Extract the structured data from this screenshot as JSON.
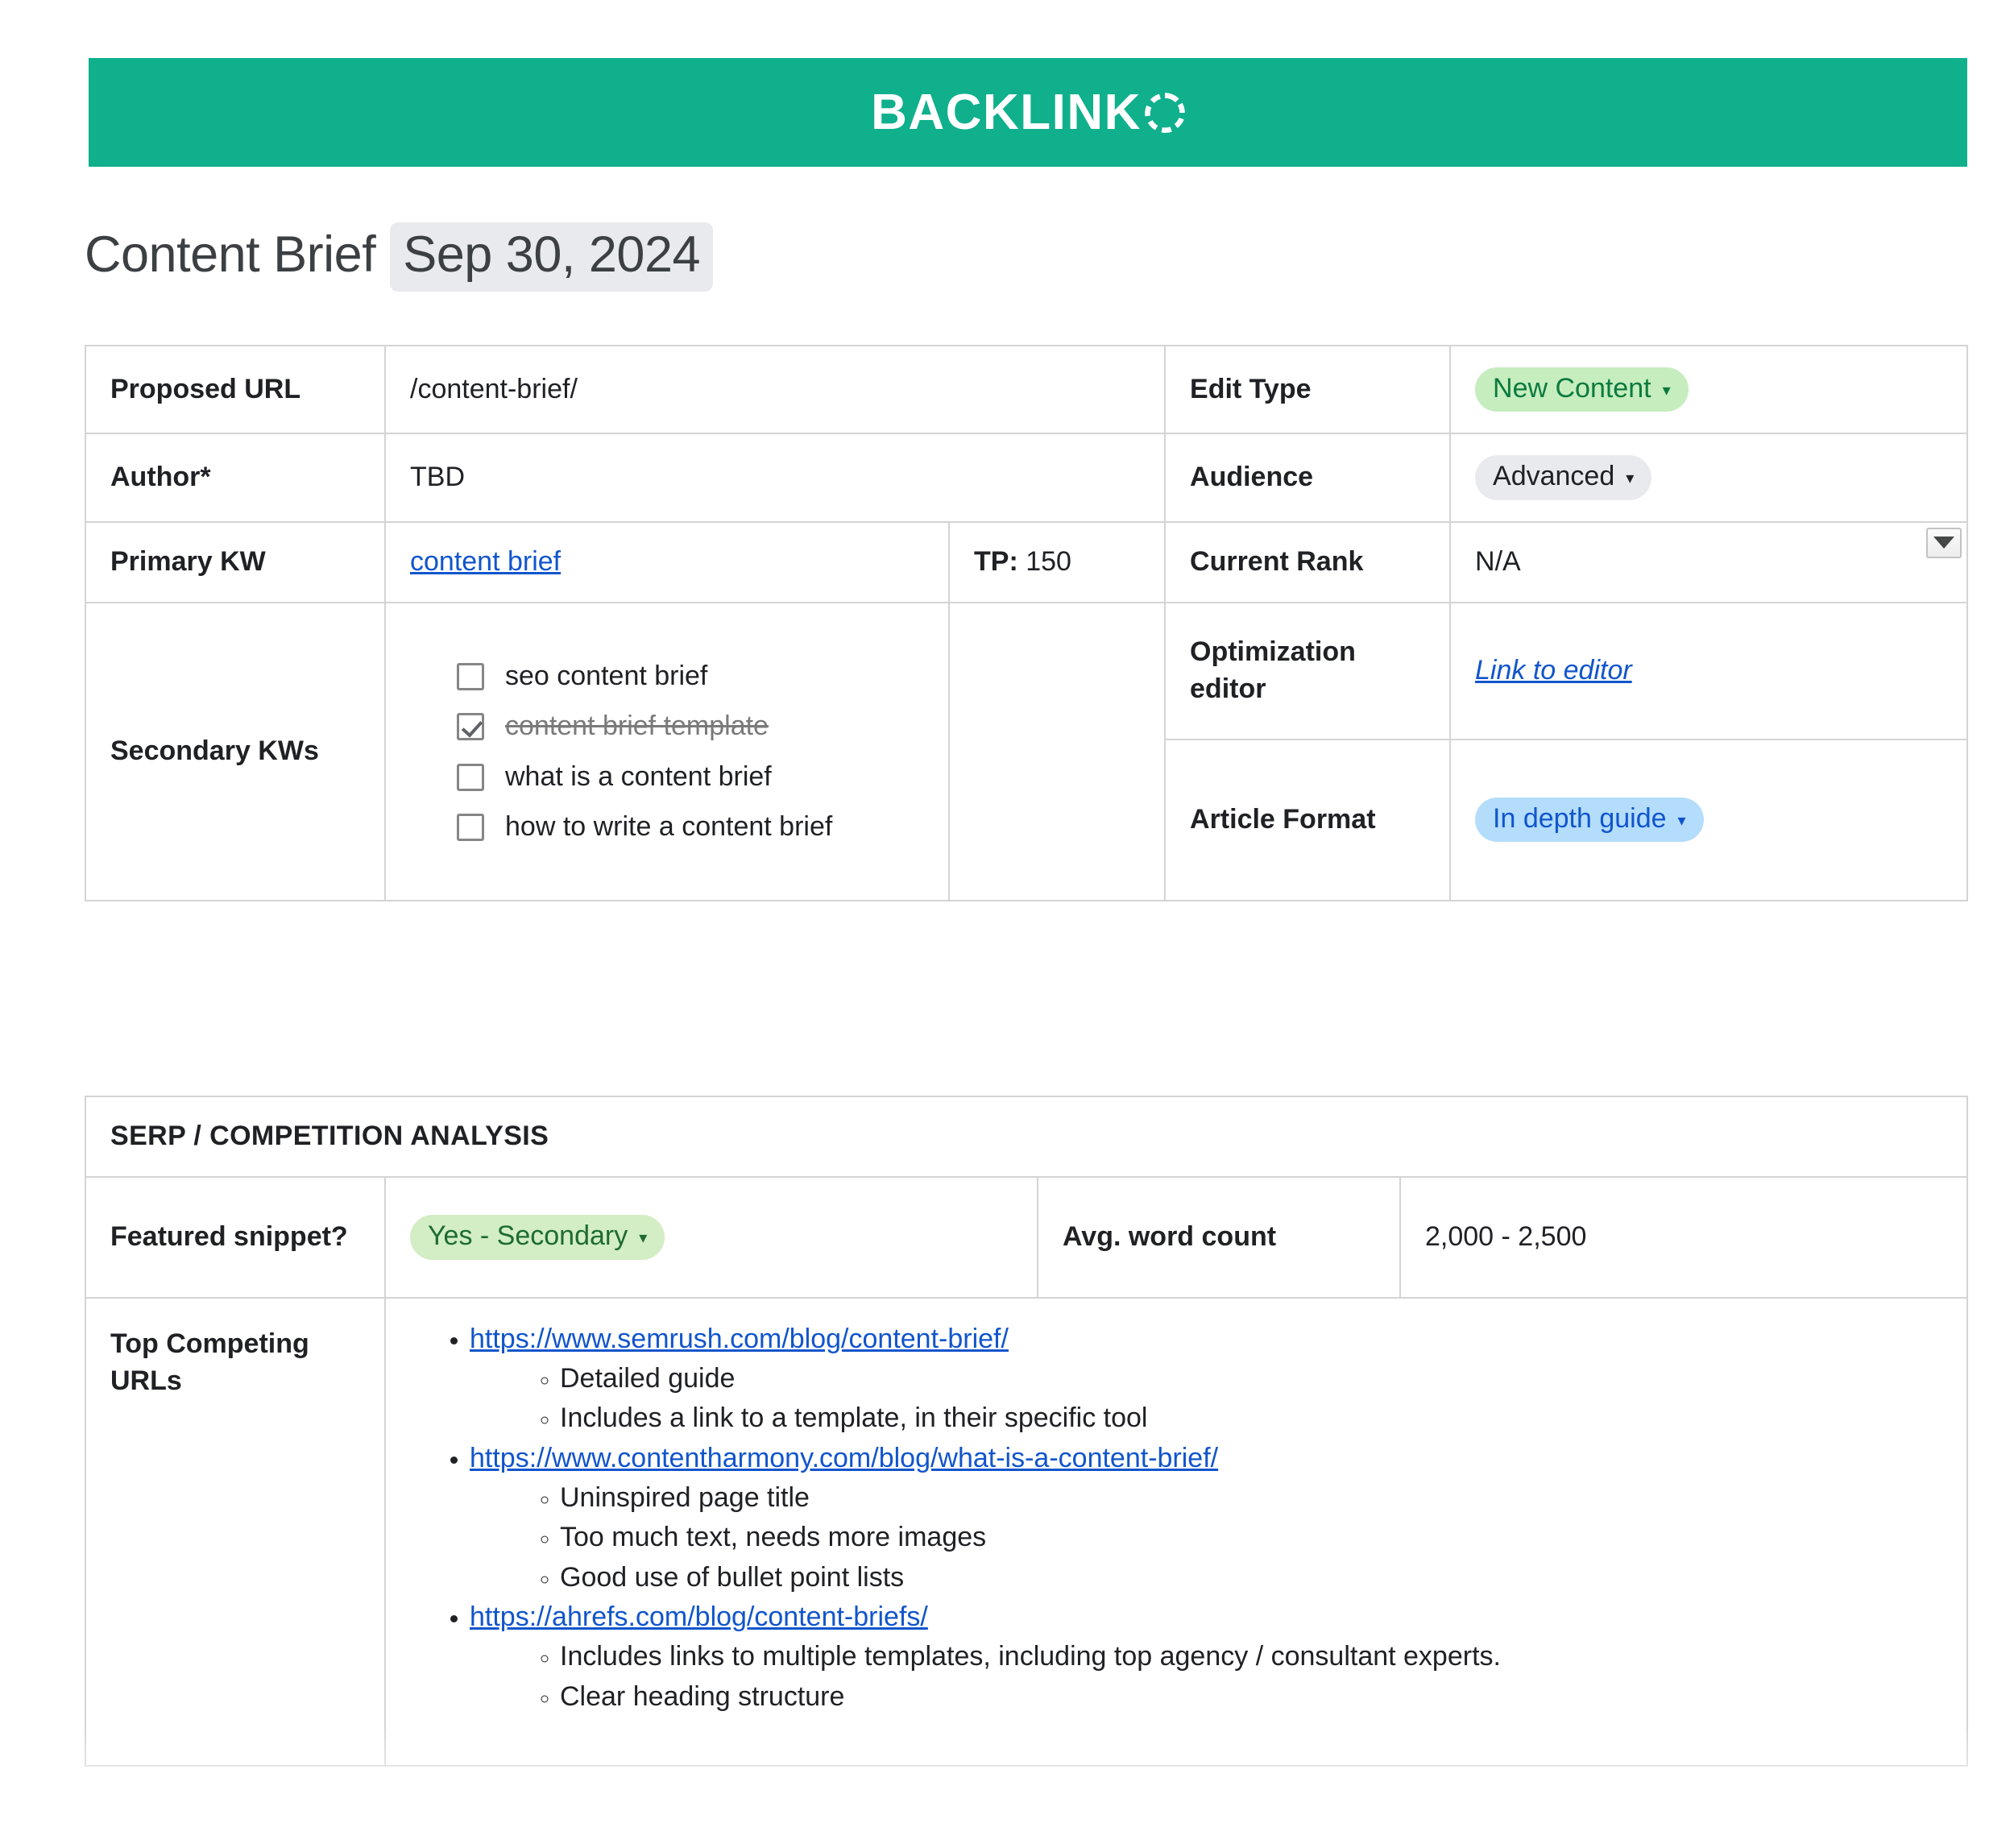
{
  "brand": {
    "name": "BACKLINK",
    "ring_icon": "ring-o-icon",
    "band_color": "#10b08d"
  },
  "title": {
    "label": "Content Brief",
    "date": "Sep 30, 2024"
  },
  "brief_table": {
    "proposed_url": {
      "label": "Proposed URL",
      "value": "/content-brief/"
    },
    "edit_type": {
      "label": "Edit Type",
      "value": "New Content",
      "chip_color": "#c6edbe"
    },
    "author": {
      "label": "Author*",
      "value": "TBD"
    },
    "audience": {
      "label": "Audience",
      "value": "Advanced",
      "chip_color": "#e8eaed"
    },
    "primary_kw": {
      "label": "Primary KW",
      "value": "content brief",
      "tp_label": "TP:",
      "tp_value": "150"
    },
    "current_rank": {
      "label": "Current Rank",
      "value": "N/A"
    },
    "secondary_kws": {
      "label": "Secondary KWs",
      "items": [
        {
          "text": "seo content brief",
          "checked": false
        },
        {
          "text": "content brief template",
          "checked": true
        },
        {
          "text": "what is a content brief",
          "checked": false
        },
        {
          "text": "how to write a content brief",
          "checked": false
        }
      ]
    },
    "optimization_editor": {
      "label": "Optimization editor",
      "link_text": "Link to editor"
    },
    "article_format": {
      "label": "Article Format",
      "value": "In depth guide",
      "chip_color": "#b3ddfb"
    },
    "dropdown_widget_icon": "chevron-down-icon"
  },
  "serp_section": {
    "header": "SERP / COMPETITION ANALYSIS",
    "header_color": "#6659a6",
    "featured_snippet": {
      "label": "Featured snippet?",
      "value": "Yes - Secondary",
      "chip_color": "#d3edc4"
    },
    "avg_word_count": {
      "label": "Avg. word count",
      "value": "2,000 - 2,500"
    },
    "top_competing_urls": {
      "label": "Top Competing URLs",
      "entries": [
        {
          "url": "https://www.semrush.com/blog/content-brief/",
          "notes": [
            "Detailed guide",
            "Includes a link to a template, in their specific tool"
          ]
        },
        {
          "url": "https://www.contentharmony.com/blog/what-is-a-content-brief/",
          "notes": [
            "Uninspired page title",
            "Too much text, needs more images",
            "Good use of bullet point lists"
          ]
        },
        {
          "url": "https://ahrefs.com/blog/content-briefs/",
          "notes": [
            "Includes links to multiple templates, including top agency / consultant experts.",
            "Clear heading structure"
          ]
        }
      ]
    }
  }
}
